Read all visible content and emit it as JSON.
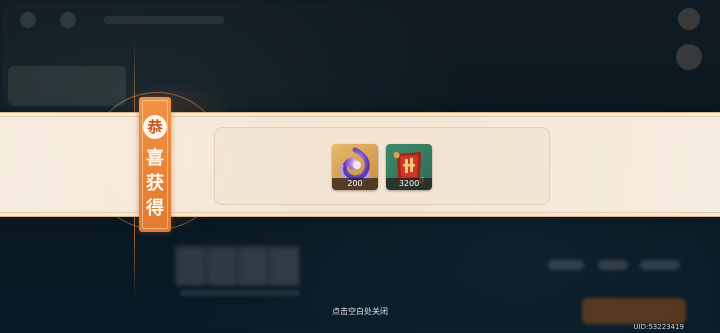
{
  "banner": {
    "ribbon_badge": "恭",
    "ribbon_chars": [
      "喜",
      "获",
      "得"
    ]
  },
  "rewards": [
    {
      "icon": "purple-crystal-icon",
      "quantity": "200"
    },
    {
      "icon": "red-scroll-icon",
      "quantity": "3200"
    }
  ],
  "footer": {
    "close_hint": "点击空白处关闭",
    "uid": "UID:53223419"
  },
  "colors": {
    "ribbon": "#e9843a",
    "banner": "#fbeede",
    "accent": "#f09245"
  }
}
